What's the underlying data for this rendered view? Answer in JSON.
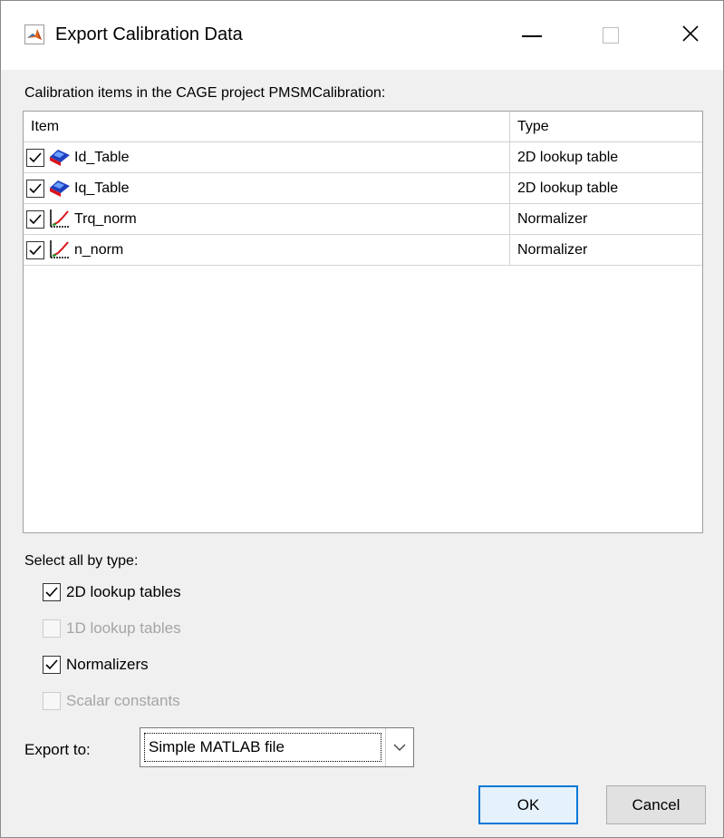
{
  "window": {
    "title": "Export Calibration Data"
  },
  "list": {
    "label": "Calibration items in the CAGE project PMSMCalibration:",
    "columns": [
      "Item",
      "Type"
    ],
    "rows": [
      {
        "name": "Id_Table",
        "type": "2D lookup table",
        "icon": "lookup-table-icon",
        "checked": true
      },
      {
        "name": "Iq_Table",
        "type": "2D lookup table",
        "icon": "lookup-table-icon",
        "checked": true
      },
      {
        "name": "Trq_norm",
        "type": "Normalizer",
        "icon": "normalizer-icon",
        "checked": true
      },
      {
        "name": "n_norm",
        "type": "Normalizer",
        "icon": "normalizer-icon",
        "checked": true
      }
    ]
  },
  "select_all": {
    "label": "Select all by type:",
    "options": [
      {
        "label": "2D lookup tables",
        "checked": true,
        "enabled": true
      },
      {
        "label": "1D lookup tables",
        "checked": false,
        "enabled": false
      },
      {
        "label": "Normalizers",
        "checked": true,
        "enabled": true
      },
      {
        "label": "Scalar constants",
        "checked": false,
        "enabled": false
      }
    ]
  },
  "export": {
    "label": "Export to:",
    "selected": "Simple MATLAB file"
  },
  "buttons": {
    "ok": "OK",
    "cancel": "Cancel"
  },
  "colors": {
    "accent": "#0078d7",
    "background": "#f0f0f0",
    "disabled_text": "#a5a5a5"
  }
}
